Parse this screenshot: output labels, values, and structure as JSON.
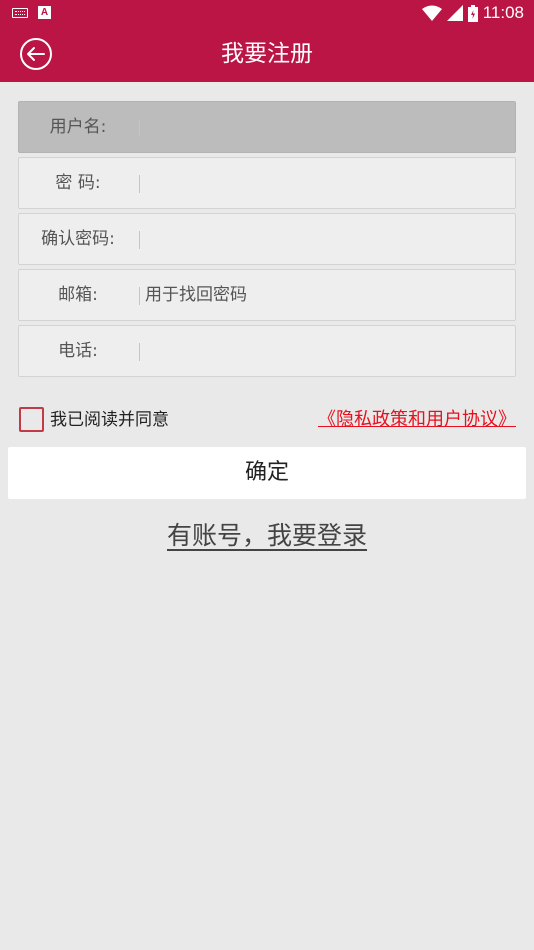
{
  "status_bar": {
    "time": "11:08",
    "left_icons": [
      "keyboard-icon",
      "text-a-icon"
    ],
    "right_icons": [
      "wifi-icon",
      "signal-icon",
      "battery-icon"
    ]
  },
  "header": {
    "title": "我要注册",
    "back_icon": "back-arrow-circle-icon"
  },
  "form": {
    "fields": [
      {
        "label": "用户名:",
        "value": "",
        "placeholder": ""
      },
      {
        "label": "密 码:",
        "value": "",
        "placeholder": ""
      },
      {
        "label": "确认密码:",
        "value": "",
        "placeholder": ""
      },
      {
        "label": "邮箱:",
        "value": "",
        "placeholder": "用于找回密码"
      },
      {
        "label": "电话:",
        "value": "",
        "placeholder": ""
      }
    ]
  },
  "agreement": {
    "text": "我已阅读并同意",
    "link": "《隐私政策和用户协议》",
    "checked": false
  },
  "confirm_button": "确定",
  "login_link": "有账号，我要登录",
  "colors": {
    "brand": "#ba1545",
    "background": "#e8e9e8",
    "link": "#e8101f"
  }
}
